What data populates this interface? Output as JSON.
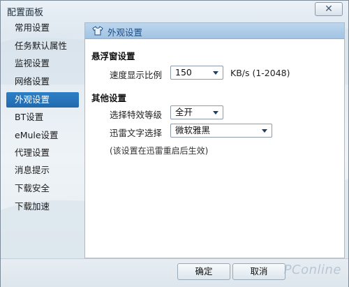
{
  "window": {
    "title": "配置面板",
    "close_glyph": "✕"
  },
  "sidebar": {
    "items": [
      {
        "label": "常用设置",
        "active": false
      },
      {
        "label": "任务默认属性",
        "active": false
      },
      {
        "label": "监视设置",
        "active": false
      },
      {
        "label": "网络设置",
        "active": false
      },
      {
        "label": "外观设置",
        "active": true
      },
      {
        "label": "BT设置",
        "active": false
      },
      {
        "label": "eMule设置",
        "active": false
      },
      {
        "label": "代理设置",
        "active": false
      },
      {
        "label": "消息提示",
        "active": false
      },
      {
        "label": "下载安全",
        "active": false
      },
      {
        "label": "下载加速",
        "active": false
      }
    ]
  },
  "content": {
    "section_title": "外观设置",
    "section_icon": "shirt-icon",
    "float_window": {
      "title": "悬浮窗设置",
      "speed_label": "速度显示比例",
      "speed_value": "150",
      "speed_unit": "KB/s (1-2048)"
    },
    "other": {
      "title": "其他设置",
      "effect_label": "选择特效等级",
      "effect_value": "全开",
      "font_label": "迅雷文字选择",
      "font_value": "微软雅黑",
      "note": "(该设置在迅雷重启后生效)"
    }
  },
  "footer": {
    "ok_label": "确定",
    "cancel_label": "取消"
  },
  "watermark": "PConline",
  "colors": {
    "accent": "#1f6aae",
    "header": "#a2c3e3"
  }
}
